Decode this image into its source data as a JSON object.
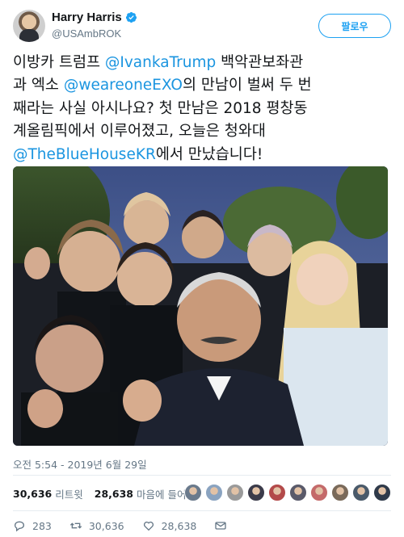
{
  "author": {
    "display_name": "Harry Harris",
    "handle": "@USAmbROK",
    "avatar_icon": "profile-avatar",
    "verified_icon": "verified-badge-icon"
  },
  "follow_button": {
    "label": "팔로우"
  },
  "tweet": {
    "lines": [
      [
        {
          "text": "이방카 트럼프 "
        },
        {
          "text": "@IvankaTrump",
          "mention": true
        },
        {
          "text": " 백악관보좌관"
        }
      ],
      [
        {
          "text": "과 엑소 "
        },
        {
          "text": "@weareoneEXO",
          "mention": true
        },
        {
          "text": "의 만남이 벌써 두 번"
        }
      ],
      [
        {
          "text": "째라는 사실 아시나요? 첫 만남은 2018 평창동"
        }
      ],
      [
        {
          "text": "계올림픽에서 이루어졌고, 오늘은 청와대"
        }
      ],
      [
        {
          "text": "@TheBlueHouseKR",
          "mention": true
        },
        {
          "text": "에서 만났습니다!"
        }
      ]
    ],
    "media": {
      "type": "photo"
    }
  },
  "timestamp": "오전 5:54 - 2019년 6월 29일",
  "stats": {
    "retweets_count": "30,636",
    "retweets_label": "리트윗",
    "likes_count": "28,638",
    "likes_label": "마음에 들어요"
  },
  "liker_avatars": [
    "#6a7a8c",
    "#8aa3c0",
    "#9a9a9a",
    "#3b3b4a",
    "#b34a4a",
    "#5a5a6a",
    "#c46a6a",
    "#7a6a5a",
    "#4a5a6a",
    "#2f3a4a"
  ],
  "actions": {
    "reply_count": "283",
    "retweet_count": "30,636",
    "like_count": "28,638"
  },
  "colors": {
    "accent": "#1da1f2",
    "mention": "#1b95e0",
    "secondary_text": "#657786"
  }
}
